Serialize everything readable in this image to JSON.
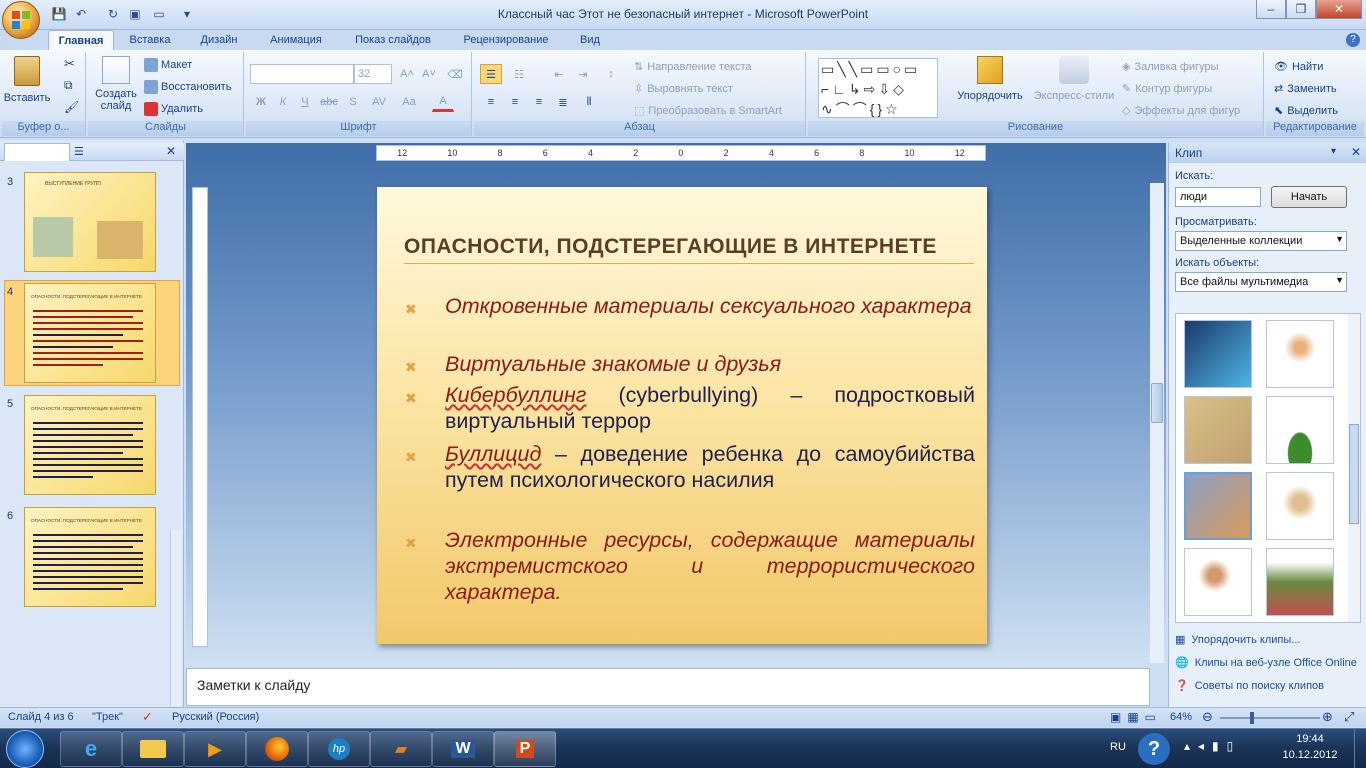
{
  "window": {
    "title": "Классный час Этот не безопасный интернет - Microsoft PowerPoint"
  },
  "tabs": [
    "Главная",
    "Вставка",
    "Дизайн",
    "Анимация",
    "Показ слайдов",
    "Рецензирование",
    "Вид"
  ],
  "ribbon": {
    "clipboard": {
      "label": "Буфер о...",
      "paste": "Вставить"
    },
    "slides": {
      "label": "Слайды",
      "new_slide": "Создать слайд",
      "layout": "Макет",
      "reset": "Восстановить",
      "delete": "Удалить"
    },
    "font": {
      "label": "Шрифт",
      "size": "32"
    },
    "paragraph": {
      "label": "Абзац",
      "text_direction": "Направление текста",
      "align_text": "Выровнять текст",
      "smartart": "Преобразовать в SmartArt"
    },
    "drawing": {
      "label": "Рисование",
      "arrange": "Упорядочить",
      "quick_styles": "Экспресс-стили",
      "fill": "Заливка фигуры",
      "outline": "Контур фигуры",
      "effects": "Эффекты для фигур"
    },
    "editing": {
      "label": "Редактирование",
      "find": "Найти",
      "replace": "Заменить",
      "select": "Выделить"
    }
  },
  "slides_pane": {
    "thumbs": [
      {
        "num": "3",
        "title": "ВЫСТУПЛЕНИЕ ГРУПП"
      },
      {
        "num": "4",
        "title": "ОПАСНОСТИ, ПОДСТЕРЕГАЮЩИЕ В ИНТЕРНЕТЕ"
      },
      {
        "num": "5",
        "title": "ОПАСНОСТИ, ПОДСТЕРЕГАЮЩИЕ В ИНТЕРНЕТЕ"
      },
      {
        "num": "6",
        "title": "ОПАСНОСТИ, ПОДСТЕРЕГАЮЩИЕ В ИНТЕРНЕТЕ"
      }
    ]
  },
  "slide": {
    "title": "ОПАСНОСТИ, ПОДСТЕРЕГАЮЩИЕ В ИНТЕРНЕТЕ",
    "b1": "Откровенные материалы сексуального характера",
    "b2": "Виртуальные знакомые и друзья",
    "b3_term": "Кибербуллинг",
    "b3_rest": " (cyberbullying) – подростковый виртуальный террор",
    "b4_term": "Буллицид",
    "b4_rest": " – доведение ребенка до самоубийства путем психологического насилия",
    "b5": "Электронные ресурсы, содержащие материалы экстремистского и террористического характера."
  },
  "notes": {
    "placeholder": "Заметки к слайду"
  },
  "clip_pane": {
    "title": "Клип",
    "search_label": "Искать:",
    "search_value": "люди",
    "go_button": "Начать",
    "browse_label": "Просматривать:",
    "browse_value": "Выделенные коллекции",
    "types_label": "Искать объекты:",
    "types_value": "Все файлы мультимедиа",
    "links": [
      "Упорядочить клипы...",
      "Клипы на веб-узле Office Online",
      "Советы по поиску клипов"
    ]
  },
  "status": {
    "slide": "Слайд 4 из 6",
    "theme": "\"Трек\"",
    "language": "Русский (Россия)",
    "zoom": "64%"
  },
  "taskbar": {
    "lang": "RU",
    "time": "19:44",
    "date": "10.12.2012"
  },
  "colors": {
    "ribbon_bg": "#dbe7f6",
    "slide_red": "#8b1a1a",
    "slide_navy": "#1f2050",
    "title_brown": "#5b3e23"
  }
}
